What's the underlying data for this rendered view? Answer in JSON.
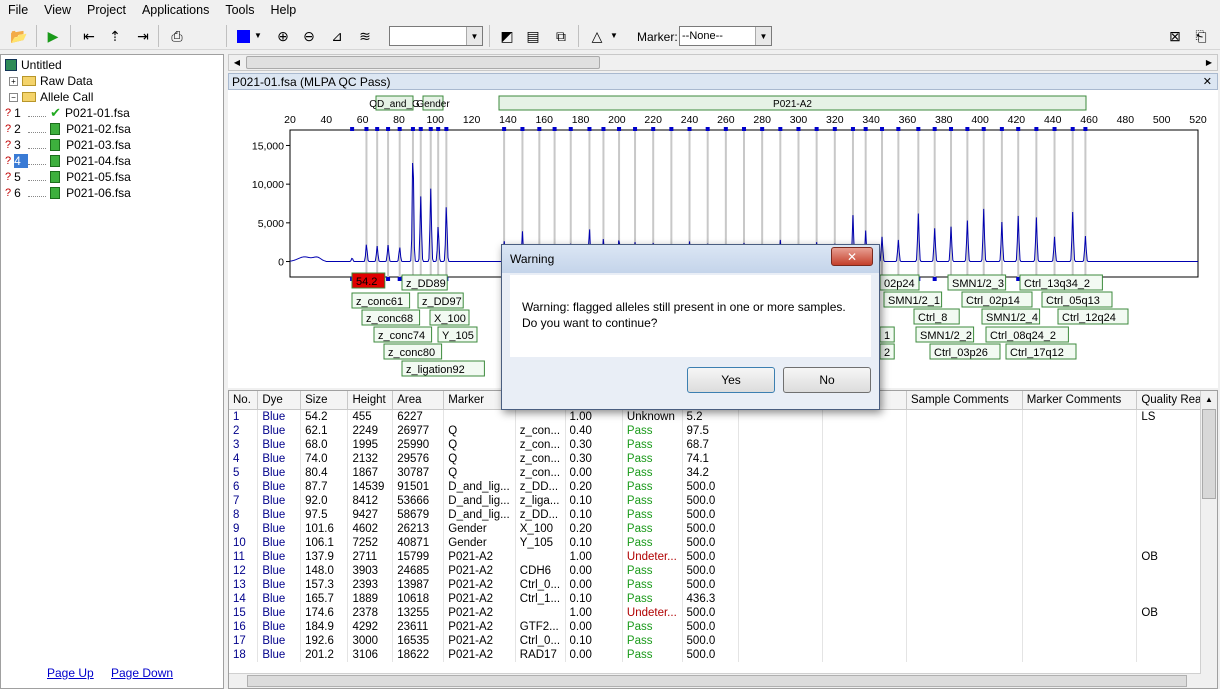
{
  "menu": [
    "File",
    "View",
    "Project",
    "Applications",
    "Tools",
    "Help"
  ],
  "toolbar": {
    "marker_label": "Marker:",
    "marker_value": "--None--",
    "dye_value": ""
  },
  "tree": {
    "root": "Untitled",
    "raw_data": "Raw Data",
    "allele_call": "Allele Call",
    "samples": [
      {
        "n": "1",
        "name": "P021-01.fsa"
      },
      {
        "n": "2",
        "name": "P021-02.fsa"
      },
      {
        "n": "3",
        "name": "P021-03.fsa"
      },
      {
        "n": "4",
        "name": "P021-04.fsa"
      },
      {
        "n": "5",
        "name": "P021-05.fsa"
      },
      {
        "n": "6",
        "name": "P021-06.fsa"
      }
    ],
    "qmark": "?"
  },
  "pages": {
    "up": "Page Up",
    "down": "Page Down"
  },
  "doc_tab": "P021-01.fsa (MLPA QC Pass)",
  "chart_data": {
    "type": "line",
    "xlim": [
      20,
      520
    ],
    "ylim": [
      -2000,
      17000
    ],
    "x_ticks": [
      20,
      40,
      60,
      80,
      100,
      120,
      140,
      160,
      180,
      200,
      220,
      240,
      260,
      280,
      300,
      320,
      340,
      360,
      380,
      400,
      420,
      440,
      460,
      480,
      500,
      520
    ],
    "y_ticks": [
      {
        "v": 0,
        "l": "0"
      },
      {
        "v": 5000,
        "l": "5,000"
      },
      {
        "v": 10000,
        "l": "10,000"
      },
      {
        "v": 15000,
        "l": "15,000"
      }
    ],
    "panels": [
      "QD_and_G",
      "Gender",
      "P021-A2"
    ],
    "peaks": [
      [
        54.2,
        455
      ],
      [
        62.1,
        2249
      ],
      [
        68.0,
        1995
      ],
      [
        74.0,
        2132
      ],
      [
        80.4,
        1867
      ],
      [
        87.7,
        14539
      ],
      [
        92.0,
        8412
      ],
      [
        97.5,
        9427
      ],
      [
        101.6,
        4602
      ],
      [
        106.1,
        7252
      ],
      [
        137.9,
        2711
      ],
      [
        148.0,
        3903
      ],
      [
        157.3,
        2393
      ],
      [
        165.7,
        1889
      ],
      [
        174.6,
        2378
      ],
      [
        184.9,
        4292
      ],
      [
        192.6,
        3000
      ],
      [
        201.2,
        3106
      ],
      [
        210,
        2500
      ],
      [
        220,
        2400
      ],
      [
        230,
        2200
      ],
      [
        240,
        2600
      ],
      [
        250,
        2300
      ],
      [
        260,
        2000
      ],
      [
        270,
        2400
      ],
      [
        280,
        2200
      ],
      [
        290,
        2800
      ],
      [
        300,
        2100
      ],
      [
        310,
        2500
      ],
      [
        320,
        2300
      ],
      [
        330,
        6000
      ],
      [
        337,
        4000
      ],
      [
        346,
        3200
      ],
      [
        355,
        2800
      ],
      [
        366,
        6200
      ],
      [
        375,
        4300
      ],
      [
        384,
        4500
      ],
      [
        393,
        5300
      ],
      [
        402,
        6800
      ],
      [
        412,
        5100
      ],
      [
        421,
        5900
      ],
      [
        431,
        5700
      ],
      [
        441,
        3200
      ],
      [
        451,
        6400
      ],
      [
        458,
        3300
      ]
    ],
    "labels_left": [
      "54.2",
      "z_DD89",
      "z_conc61",
      "z_DD97",
      "z_conc68",
      "X_100",
      "z_conc74",
      "Y_105",
      "z_conc80",
      "z_ligation92"
    ],
    "labels_right": [
      "02p24",
      "SMN1/2_3",
      "Ctrl_13q34_2",
      "SMN1/2_1",
      "Ctrl_02p14",
      "Ctrl_05q13",
      "Ctrl_8",
      "SMN1/2_4",
      "Ctrl_12q24",
      "SMN1/2_2",
      "Ctrl_08q24_2",
      "Ctrl_03p26",
      "Ctrl_17q12",
      "1",
      "2"
    ]
  },
  "table": {
    "columns": [
      "No.",
      "Dye",
      "Size",
      "Height",
      "Area",
      "Marker",
      "",
      "",
      "",
      "Unknown",
      "",
      "",
      "Sample Comments",
      "Marker Comments",
      "Quality Rea..."
    ],
    "rows": [
      [
        "1",
        "Blue",
        "54.2",
        "455",
        "6227",
        "",
        "",
        "1.00",
        "Unknown",
        "5.2",
        "LS"
      ],
      [
        "2",
        "Blue",
        "62.1",
        "2249",
        "26977",
        "Q",
        "z_con...",
        "0.40",
        "Pass",
        "97.5",
        ""
      ],
      [
        "3",
        "Blue",
        "68.0",
        "1995",
        "25990",
        "Q",
        "z_con...",
        "0.30",
        "Pass",
        "68.7",
        ""
      ],
      [
        "4",
        "Blue",
        "74.0",
        "2132",
        "29576",
        "Q",
        "z_con...",
        "0.30",
        "Pass",
        "74.1",
        ""
      ],
      [
        "5",
        "Blue",
        "80.4",
        "1867",
        "30787",
        "Q",
        "z_con...",
        "0.00",
        "Pass",
        "34.2",
        ""
      ],
      [
        "6",
        "Blue",
        "87.7",
        "14539",
        "91501",
        "D_and_lig...",
        "z_DD...",
        "0.20",
        "Pass",
        "500.0",
        ""
      ],
      [
        "7",
        "Blue",
        "92.0",
        "8412",
        "53666",
        "D_and_lig...",
        "z_liga...",
        "0.10",
        "Pass",
        "500.0",
        ""
      ],
      [
        "8",
        "Blue",
        "97.5",
        "9427",
        "58679",
        "D_and_lig...",
        "z_DD...",
        "0.10",
        "Pass",
        "500.0",
        ""
      ],
      [
        "9",
        "Blue",
        "101.6",
        "4602",
        "26213",
        "Gender",
        "X_100",
        "0.20",
        "Pass",
        "500.0",
        ""
      ],
      [
        "10",
        "Blue",
        "106.1",
        "7252",
        "40871",
        "Gender",
        "Y_105",
        "0.10",
        "Pass",
        "500.0",
        ""
      ],
      [
        "11",
        "Blue",
        "137.9",
        "2711",
        "15799",
        "P021-A2",
        "",
        "1.00",
        "Undeter...",
        "500.0",
        "OB"
      ],
      [
        "12",
        "Blue",
        "148.0",
        "3903",
        "24685",
        "P021-A2",
        "CDH6",
        "0.00",
        "Pass",
        "500.0",
        ""
      ],
      [
        "13",
        "Blue",
        "157.3",
        "2393",
        "13987",
        "P021-A2",
        "Ctrl_0...",
        "0.00",
        "Pass",
        "500.0",
        ""
      ],
      [
        "14",
        "Blue",
        "165.7",
        "1889",
        "10618",
        "P021-A2",
        "Ctrl_1...",
        "0.10",
        "Pass",
        "436.3",
        ""
      ],
      [
        "15",
        "Blue",
        "174.6",
        "2378",
        "13255",
        "P021-A2",
        "",
        "1.00",
        "Undeter...",
        "500.0",
        "OB"
      ],
      [
        "16",
        "Blue",
        "184.9",
        "4292",
        "23611",
        "P021-A2",
        "GTF2...",
        "0.00",
        "Pass",
        "500.0",
        ""
      ],
      [
        "17",
        "Blue",
        "192.6",
        "3000",
        "16535",
        "P021-A2",
        "Ctrl_0...",
        "0.10",
        "Pass",
        "500.0",
        ""
      ],
      [
        "18",
        "Blue",
        "201.2",
        "3106",
        "18622",
        "P021-A2",
        "RAD17",
        "0.00",
        "Pass",
        "500.0",
        ""
      ]
    ]
  },
  "dialog": {
    "title": "Warning",
    "line1": "Warning: flagged alleles still present in one or more samples.",
    "line2": "Do you want to continue?",
    "yes": "Yes",
    "no": "No",
    "close": "✕"
  }
}
